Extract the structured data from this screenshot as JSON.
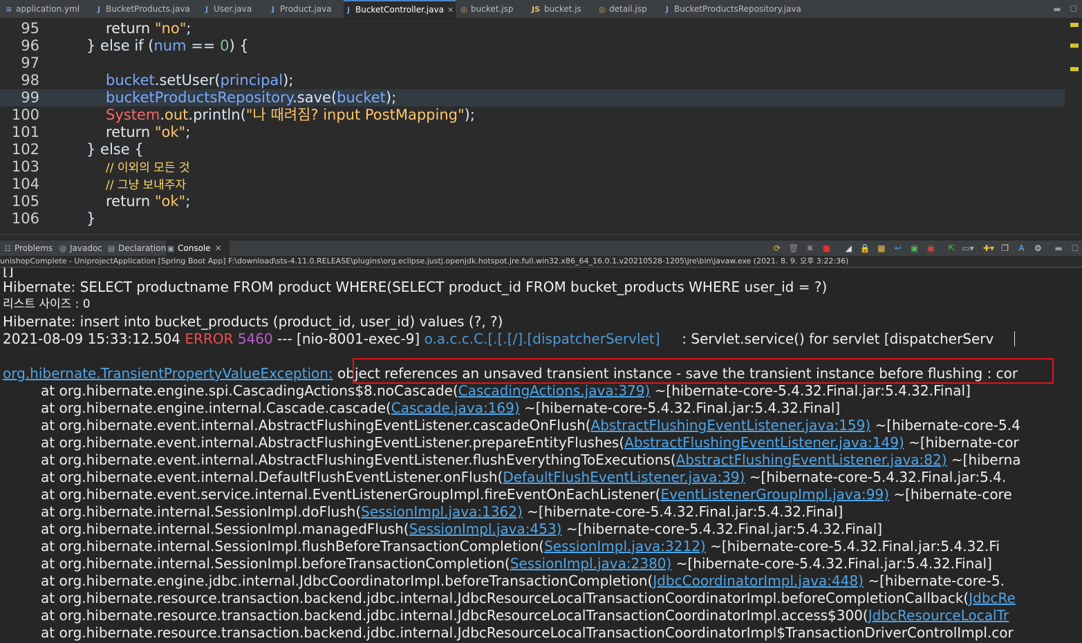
{
  "editor_tabs": [
    {
      "label": "application.yml",
      "icon": "yml-file-icon"
    },
    {
      "label": "BucketProducts.java",
      "icon": "java-file-icon"
    },
    {
      "label": "User.java",
      "icon": "java-file-icon"
    },
    {
      "label": "Product.java",
      "icon": "java-file-icon"
    },
    {
      "label": "BucketController.java",
      "icon": "java-file-icon",
      "active": true
    },
    {
      "label": "bucket.jsp",
      "icon": "jsp-file-icon"
    },
    {
      "label": "bucket.js",
      "icon": "js-file-icon"
    },
    {
      "label": "detail.jsp",
      "icon": "jsp-file-icon"
    },
    {
      "label": "BucketProductsRepository.java",
      "icon": "java-file-icon"
    }
  ],
  "editor": {
    "line_numbers": [
      "95",
      "96",
      "97",
      "98",
      "99",
      "100",
      "101",
      "102",
      "103",
      "104",
      "105",
      "106"
    ],
    "l95": {
      "kw": "return ",
      "str": "\"no\"",
      "end": ";"
    },
    "l96": {
      "a": "} else if (",
      "var": "num",
      "b": " == ",
      "num": "0",
      "c": ") {"
    },
    "l98": {
      "var1": "bucket",
      "a": ".setUser(",
      "var2": "principal",
      "b": ");"
    },
    "l99": {
      "var1": "bucketProductsRepository",
      "a": ".save(",
      "var2": "bucket",
      "b": ");"
    },
    "l100": {
      "sys": "System",
      "dot": ".",
      "fld": "out",
      "a": ".println(",
      "str": "\"나 때려짐? input PostMapping\"",
      "b": ");"
    },
    "l101": {
      "kw": "return ",
      "str": "\"ok\"",
      "end": ";"
    },
    "l102": {
      "text": "} else {"
    },
    "l103": {
      "text": "// 이외의 모든 것"
    },
    "l104": {
      "text": "// 그냥 보내주자"
    },
    "l105": {
      "kw": "return ",
      "str": "\"ok\"",
      "end": ";"
    },
    "l106": {
      "text": "}"
    }
  },
  "view_tabs": [
    {
      "label": "Problems",
      "icon": "problems-icon"
    },
    {
      "label": "Javadoc",
      "icon": "at-sign-icon"
    },
    {
      "label": "Declaration",
      "icon": "declaration-icon"
    },
    {
      "label": "Console",
      "icon": "console-icon",
      "active": true
    }
  ],
  "console": {
    "launch_info": "unishopComplete - UniprojectApplication [Spring Boot App] F:\\download\\sts-4.11.0.RELEASE\\plugins\\org.eclipse.justj.openjdk.hotspot.jre.full.win32.x86_64_16.0.1.v20210528-1205\\jre\\bin\\javaw.exe  (2021. 8. 9. 오후 3:22:36)",
    "line0": "[]",
    "line1": "Hibernate: SELECT productname FROM product WHERE(SELECT product_id FROM bucket_products WHERE user_id = ?)",
    "line2": "리스트 사이즈 : 0",
    "line3": "Hibernate: insert into bucket_products (product_id, user_id) values (?, ?)",
    "line4": {
      "timestamp": "2021-08-09 15:33:12.504 ",
      "level": "ERROR",
      "pid": " 5460",
      "thread": " --- [nio-8001-exec-9] ",
      "logger": "o.a.c.c.C.[.[.[/].[dispatcherServlet]",
      "message": "     : Servlet.service() for servlet [dispatcherServ"
    },
    "exception": {
      "class": "org.hibernate.TransientPropertyValueException",
      "sep": ":",
      "message": " object references an unsaved transient instance - save the transient instance before flushing : cor"
    },
    "stack": [
      {
        "method": "at org.hibernate.engine.spi.CascadingActions$8.noCascade(",
        "link": "CascadingActions.java:379)",
        "tail": " ~[hibernate-core-5.4.32.Final.jar:5.4.32.Final]"
      },
      {
        "method": "at org.hibernate.engine.internal.Cascade.cascade(",
        "link": "Cascade.java:169)",
        "tail": " ~[hibernate-core-5.4.32.Final.jar:5.4.32.Final]"
      },
      {
        "method": "at org.hibernate.event.internal.AbstractFlushingEventListener.cascadeOnFlush(",
        "link": "AbstractFlushingEventListener.java:159)",
        "tail": " ~[hibernate-core-5.4"
      },
      {
        "method": "at org.hibernate.event.internal.AbstractFlushingEventListener.prepareEntityFlushes(",
        "link": "AbstractFlushingEventListener.java:149)",
        "tail": " ~[hibernate-cor"
      },
      {
        "method": "at org.hibernate.event.internal.AbstractFlushingEventListener.flushEverythingToExecutions(",
        "link": "AbstractFlushingEventListener.java:82)",
        "tail": " ~[hiberna"
      },
      {
        "method": "at org.hibernate.event.internal.DefaultFlushEventListener.onFlush(",
        "link": "DefaultFlushEventListener.java:39)",
        "tail": " ~[hibernate-core-5.4.32.Final.jar:5.4."
      },
      {
        "method": "at org.hibernate.event.service.internal.EventListenerGroupImpl.fireEventOnEachListener(",
        "link": "EventListenerGroupImpl.java:99)",
        "tail": " ~[hibernate-core"
      },
      {
        "method": "at org.hibernate.internal.SessionImpl.doFlush(",
        "link": "SessionImpl.java:1362)",
        "tail": " ~[hibernate-core-5.4.32.Final.jar:5.4.32.Final]"
      },
      {
        "method": "at org.hibernate.internal.SessionImpl.managedFlush(",
        "link": "SessionImpl.java:453)",
        "tail": " ~[hibernate-core-5.4.32.Final.jar:5.4.32.Final]"
      },
      {
        "method": "at org.hibernate.internal.SessionImpl.flushBeforeTransactionCompletion(",
        "link": "SessionImpl.java:3212)",
        "tail": " ~[hibernate-core-5.4.32.Final.jar:5.4.32.Fi"
      },
      {
        "method": "at org.hibernate.internal.SessionImpl.beforeTransactionCompletion(",
        "link": "SessionImpl.java:2380)",
        "tail": " ~[hibernate-core-5.4.32.Final.jar:5.4.32.Final]"
      },
      {
        "method": "at org.hibernate.engine.jdbc.internal.JdbcCoordinatorImpl.beforeTransactionCompletion(",
        "link": "JdbcCoordinatorImpl.java:448)",
        "tail": " ~[hibernate-core-5."
      },
      {
        "method": "at org.hibernate.resource.transaction.backend.jdbc.internal.JdbcResourceLocalTransactionCoordinatorImpl.beforeCompletionCallback(",
        "link": "JdbcRe",
        "tail": ""
      },
      {
        "method": "at org.hibernate.resource.transaction.backend.jdbc.internal.JdbcResourceLocalTransactionCoordinatorImpl.access$300(",
        "link": "JdbcResourceLocalTr",
        "tail": ""
      },
      {
        "method": "at org.hibernate.resource.transaction.backend.jdbc.internal.JdbcResourceLocalTransactionCoordinatorImpl$TransactionDriverControlImpl.cor",
        "link": "",
        "tail": ""
      }
    ]
  },
  "colors": {
    "background": "#2b2b2b",
    "error": "#f14c4c",
    "link": "#4ea6ea",
    "highlight_box": "#e0141b",
    "string": "#ffc66d",
    "variable": "#79abff"
  }
}
